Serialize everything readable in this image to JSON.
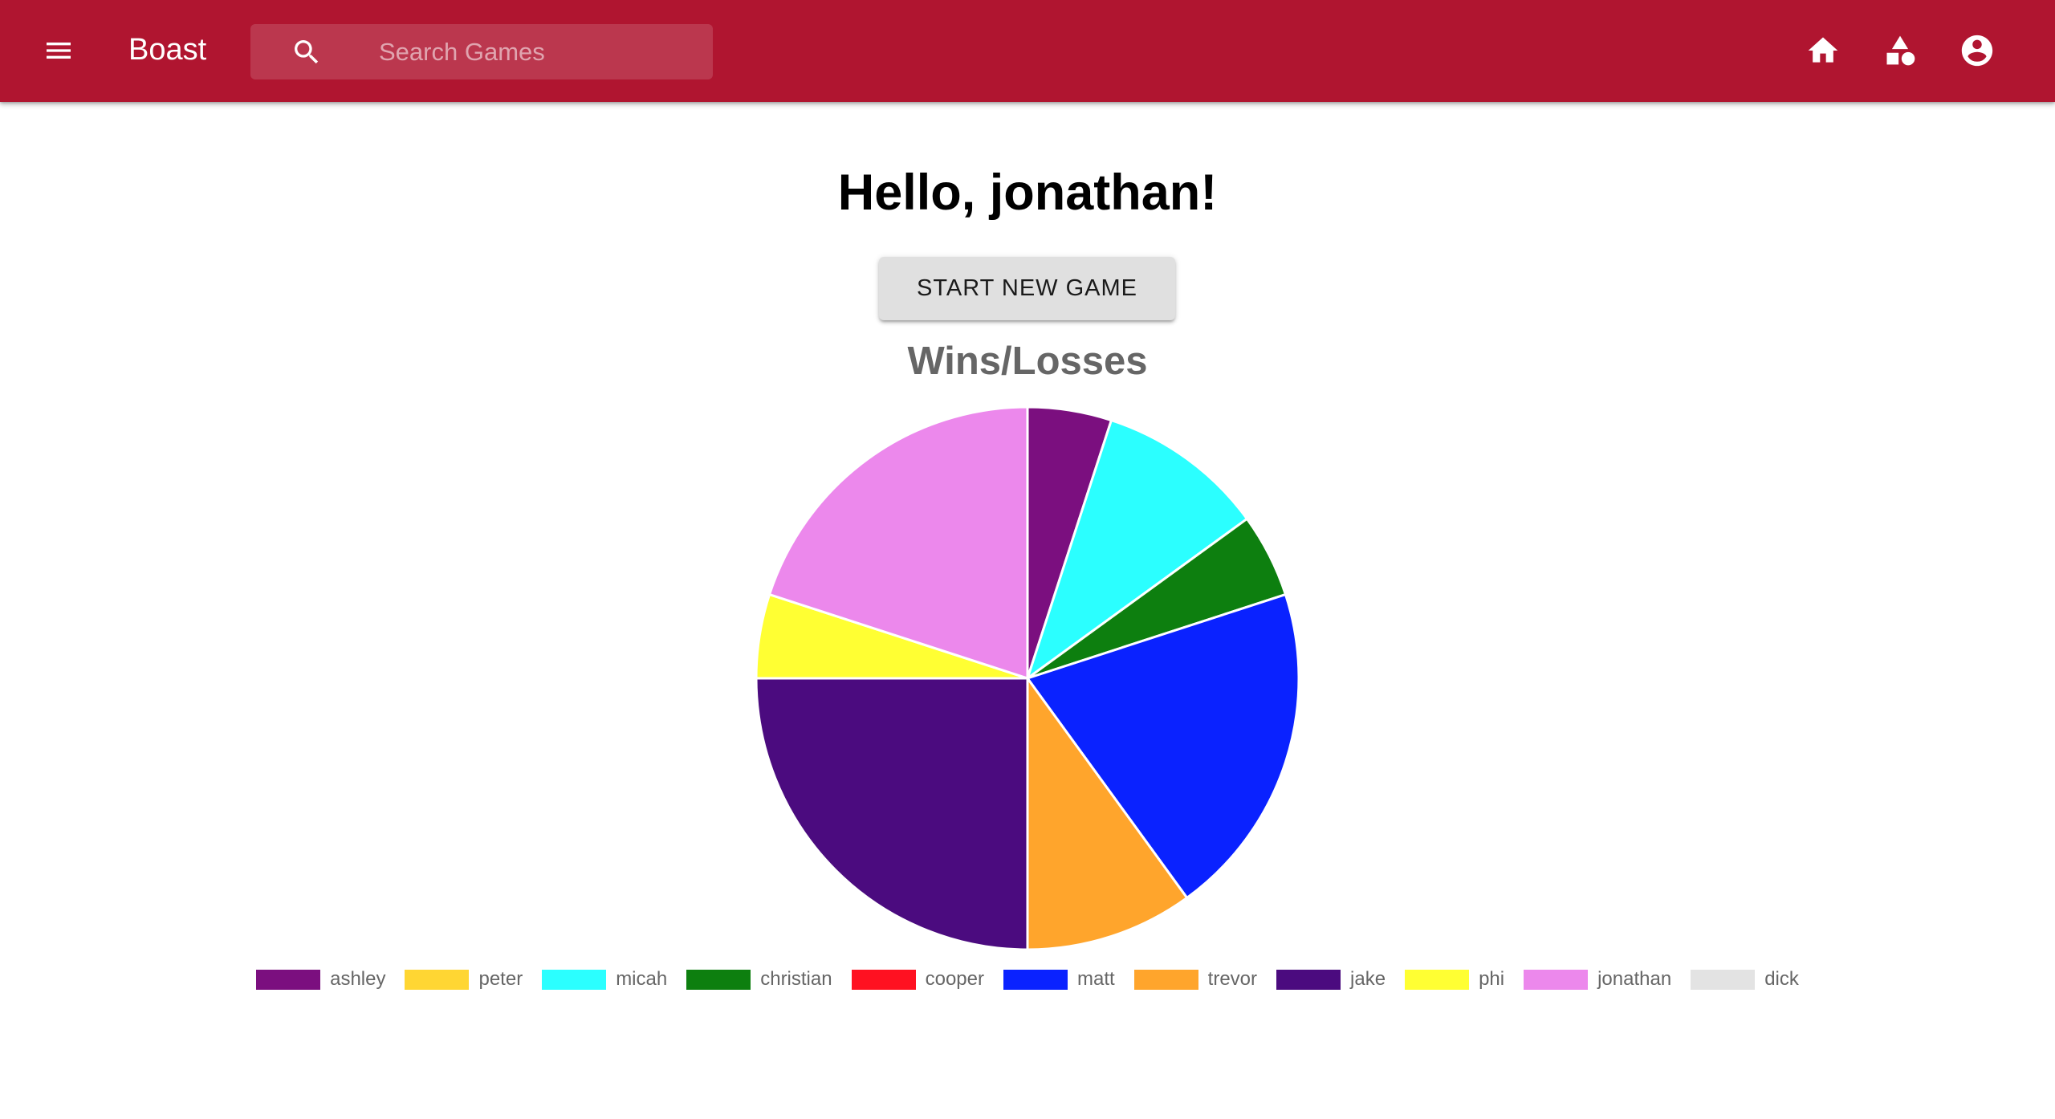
{
  "appbar": {
    "brand": "Boast",
    "search_placeholder": "Search Games",
    "color": "#b01530",
    "icons": [
      "menu-icon",
      "search-icon",
      "home-icon",
      "category-icon",
      "account-circle-icon"
    ]
  },
  "main": {
    "greeting": "Hello, jonathan!",
    "start_button": "START NEW GAME"
  },
  "chart_data": {
    "type": "pie",
    "title": "Wins/Losses",
    "legend_position": "bottom",
    "categories": [
      "ashley",
      "peter",
      "micah",
      "christian",
      "cooper",
      "matt",
      "trevor",
      "jake",
      "phi",
      "jonathan",
      "dick"
    ],
    "values": [
      1,
      0,
      2,
      1,
      0,
      4,
      2,
      5,
      1,
      4,
      0
    ],
    "colors": [
      "#7b0f7f",
      "#ffd633",
      "#2bffff",
      "#0d7f0f",
      "#ff1121",
      "#0a22ff",
      "#ffa52c",
      "#4b0b7f",
      "#ffff33",
      "#ec88ec",
      "#e3e3e3"
    ]
  }
}
